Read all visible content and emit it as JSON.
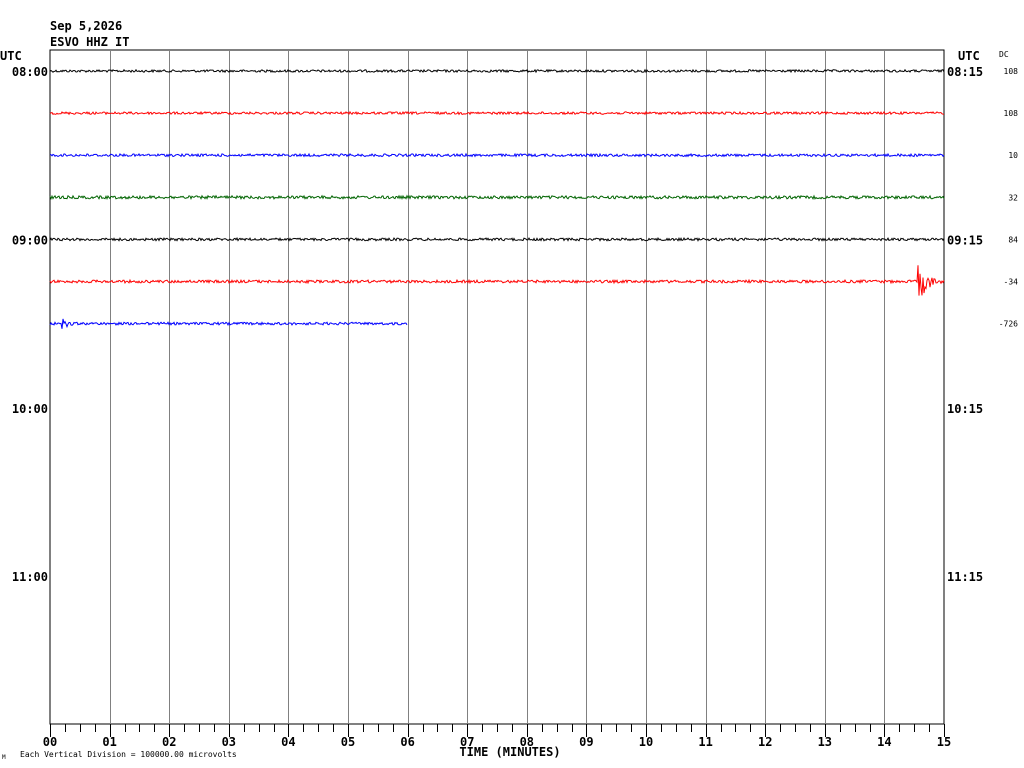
{
  "header": {
    "date": "Sep 5,2026",
    "station": "ESVO HHZ IT"
  },
  "chart_data": {
    "type": "line",
    "subtype": "helicorder",
    "xlabel": "TIME (MINUTES)",
    "x_ticks": [
      "00",
      "01",
      "02",
      "03",
      "04",
      "05",
      "06",
      "07",
      "08",
      "09",
      "10",
      "11",
      "12",
      "13",
      "14",
      "15"
    ],
    "xlim": [
      0,
      15
    ],
    "left_axis": {
      "title": "UTC",
      "labels": [
        "08:00",
        "09:00",
        "10:00",
        "11:00"
      ]
    },
    "right_axis": {
      "title": "UTC",
      "dc_title": "DC",
      "labels": [
        "08:15",
        "09:15",
        "10:15",
        "11:15"
      ]
    },
    "rows_per_hour": 4,
    "total_rows": 16,
    "grid": true,
    "footer_note": "Each Vertical Division = 100000.00 microvolts",
    "footer_mark": "M",
    "traces": [
      {
        "row": 0,
        "color": "#000000",
        "dc": "108",
        "end_minute": 15,
        "noise": 1.2,
        "events": []
      },
      {
        "row": 1,
        "color": "#ff0000",
        "dc": "108",
        "end_minute": 15,
        "noise": 1.2,
        "events": []
      },
      {
        "row": 2,
        "color": "#0000ff",
        "dc": "10",
        "end_minute": 15,
        "noise": 1.3,
        "events": []
      },
      {
        "row": 3,
        "color": "#006400",
        "dc": "32",
        "end_minute": 15,
        "noise": 1.5,
        "events": []
      },
      {
        "row": 4,
        "color": "#000000",
        "dc": "84",
        "end_minute": 15,
        "noise": 1.3,
        "events": []
      },
      {
        "row": 5,
        "color": "#ff0000",
        "dc": "-34",
        "end_minute": 15,
        "noise": 1.4,
        "events": [
          {
            "minute": 14.55,
            "amplitude": 24,
            "duration": 0.45
          }
        ]
      },
      {
        "row": 6,
        "color": "#0000ff",
        "dc": "-726",
        "end_minute": 6.0,
        "noise": 1.3,
        "events": [
          {
            "minute": 0.2,
            "amplitude": 6,
            "duration": 0.4
          }
        ]
      }
    ]
  }
}
